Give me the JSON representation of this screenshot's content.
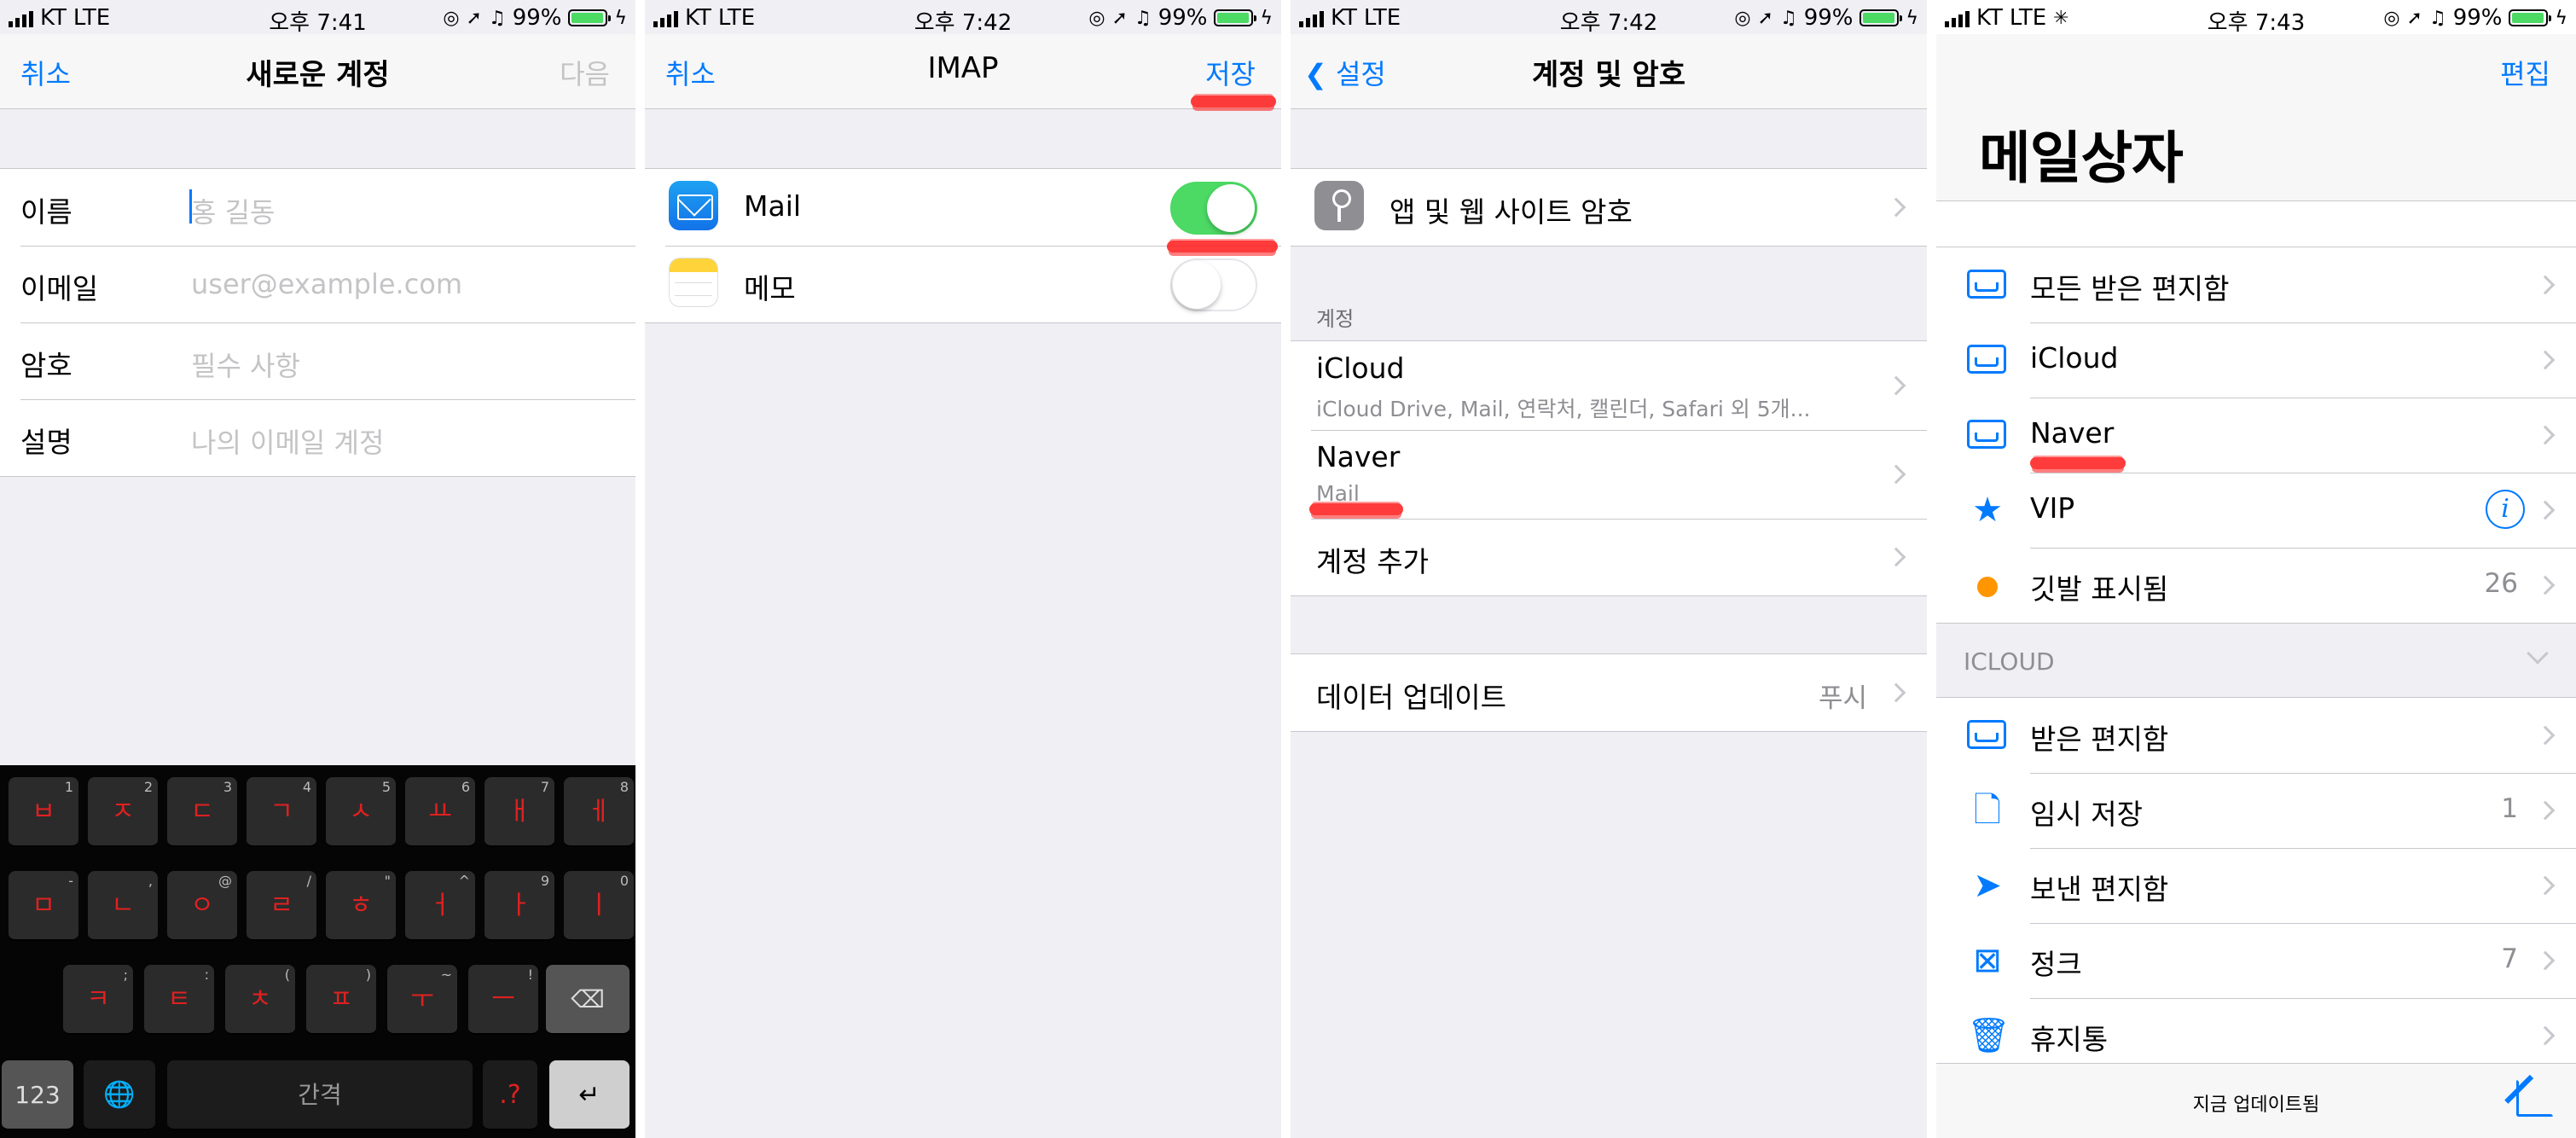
{
  "status_bars": [
    {
      "carrier": "KT",
      "network": "LTE",
      "time": "오후 7:41",
      "battery": "99%"
    },
    {
      "carrier": "KT",
      "network": "LTE",
      "time": "오후 7:42",
      "battery": "99%"
    },
    {
      "carrier": "KT",
      "network": "LTE",
      "time": "오후 7:42",
      "battery": "99%"
    },
    {
      "carrier": "KT",
      "network": "LTE",
      "time": "오후 7:43",
      "battery": "99%"
    }
  ],
  "new_account": {
    "title": "새로운 계정",
    "cancel": "취소",
    "next": "다음",
    "fields": [
      {
        "label": "이름",
        "placeholder": "홍 길동"
      },
      {
        "label": "이메일",
        "placeholder": "user@example.com"
      },
      {
        "label": "암호",
        "placeholder": "필수 사항"
      },
      {
        "label": "설명",
        "placeholder": "나의 이메일 계정"
      }
    ],
    "keyboard": {
      "row1": [
        {
          "k": "ㅂ",
          "s": "1"
        },
        {
          "k": "ㅈ",
          "s": "2"
        },
        {
          "k": "ㄷ",
          "s": "3"
        },
        {
          "k": "ㄱ",
          "s": "4"
        },
        {
          "k": "ㅅ",
          "s": "5"
        },
        {
          "k": "ㅛ",
          "s": "6"
        },
        {
          "k": "ㅐ",
          "s": "7"
        },
        {
          "k": "ㅔ",
          "s": "8"
        }
      ],
      "row2": [
        {
          "k": "ㅁ",
          "s": "-"
        },
        {
          "k": "ㄴ",
          "s": ","
        },
        {
          "k": "ㅇ",
          "s": "@"
        },
        {
          "k": "ㄹ",
          "s": "/"
        },
        {
          "k": "ㅎ",
          "s": "\""
        },
        {
          "k": "ㅓ",
          "s": "^"
        },
        {
          "k": "ㅏ",
          "s": "9"
        },
        {
          "k": "ㅣ",
          "s": "0"
        }
      ],
      "row3": [
        {
          "k": "ㅋ",
          "s": ";"
        },
        {
          "k": "ㅌ",
          "s": ":"
        },
        {
          "k": "ㅊ",
          "s": "("
        },
        {
          "k": "ㅍ",
          "s": ")"
        },
        {
          "k": "ㅜ",
          "s": "~"
        },
        {
          "k": "ㅡ",
          "s": "!"
        }
      ],
      "numbers": "123",
      "space": "간격",
      "punct": ".?",
      "delete": "⌫",
      "return": "↵",
      "globe": "🌐"
    }
  },
  "imap": {
    "title": "IMAP",
    "cancel": "취소",
    "save": "저장",
    "apps": [
      {
        "name": "Mail",
        "enabled": true
      },
      {
        "name": "메모",
        "enabled": false
      }
    ]
  },
  "accounts": {
    "back": "설정",
    "title": "계정 및 암호",
    "passwords_row": "앱 및 웹 사이트 암호",
    "section_header": "계정",
    "accounts_list": [
      {
        "name": "iCloud",
        "detail": "iCloud Drive, Mail, 연락처, 캘린더, Safari 외 5개..."
      },
      {
        "name": "Naver",
        "detail": "Mail"
      }
    ],
    "add_account": "계정 추가",
    "fetch_label": "데이터 업데이트",
    "fetch_value": "푸시"
  },
  "mailboxes": {
    "edit": "편집",
    "title": "메일상자",
    "top": [
      {
        "name": "모든 받은 편지함",
        "icon": "inboxes-icon",
        "count": ""
      },
      {
        "name": "iCloud",
        "icon": "inbox-icon",
        "count": ""
      },
      {
        "name": "Naver",
        "icon": "inbox-icon",
        "count": ""
      },
      {
        "name": "VIP",
        "icon": "star-icon",
        "count": ""
      },
      {
        "name": "깃발 표시됨",
        "icon": "flag-dot-icon",
        "count": "26"
      }
    ],
    "icloud_header": "ICLOUD",
    "icloud": [
      {
        "name": "받은 편지함",
        "icon": "inbox-icon",
        "count": ""
      },
      {
        "name": "임시 저장",
        "icon": "draft-icon",
        "count": "1"
      },
      {
        "name": "보낸 편지함",
        "icon": "sent-icon",
        "count": ""
      },
      {
        "name": "정크",
        "icon": "junk-icon",
        "count": "7"
      },
      {
        "name": "휴지통",
        "icon": "trash-icon",
        "count": ""
      }
    ],
    "updated": "지금 업데이트됨",
    "glyphs": {
      "star": "★",
      "info": "i",
      "draft": "🗋",
      "sent": "➤",
      "junk": "⊠",
      "trash": "🗑"
    }
  },
  "colors": {
    "accent": "#007aff",
    "toggle_on": "#4cd964",
    "flag": "#ff9500",
    "mark": "#ff1a1a"
  }
}
